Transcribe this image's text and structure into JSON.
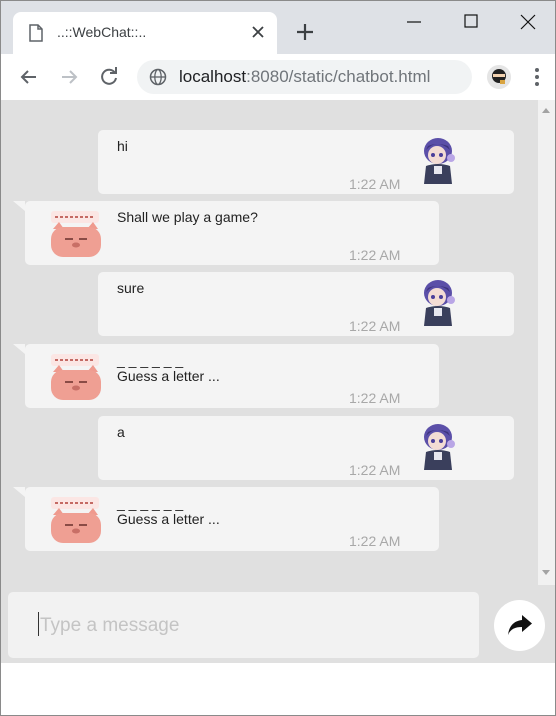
{
  "browser": {
    "tab_title": "..::WebChat::..",
    "url_host": "localhost",
    "url_path": ":8080/static/chatbot.html",
    "icons": {
      "tab": "page-icon",
      "close": "close-icon",
      "new_tab": "plus-icon",
      "back": "back-arrow-icon",
      "forward": "forward-arrow-icon",
      "reload": "reload-icon",
      "site_info": "globe-icon",
      "profile": "profile-avatar-icon",
      "menu": "kebab-menu-icon"
    }
  },
  "chat": {
    "messages": [
      {
        "sender": "user",
        "lines": [
          "hi"
        ],
        "time": "1:22 AM"
      },
      {
        "sender": "bot",
        "lines": [
          "Shall we play a game?"
        ],
        "time": "1:22 AM"
      },
      {
        "sender": "user",
        "lines": [
          "sure"
        ],
        "time": "1:22 AM"
      },
      {
        "sender": "bot",
        "lines": [
          "_ _ _ _ _ _",
          "Guess a letter ..."
        ],
        "time": "1:22 AM"
      },
      {
        "sender": "user",
        "lines": [
          "a"
        ],
        "time": "1:22 AM"
      },
      {
        "sender": "bot",
        "lines": [
          "_ _ _ _ _ _",
          "Guess a letter ..."
        ],
        "time": "1:22 AM"
      }
    ],
    "input_placeholder": "Type a message",
    "send_icon": "share-arrow-icon"
  },
  "colors": {
    "chat_background": "#e0e0e0",
    "bubble": "#f4f4f4",
    "timestamp": "#a8a8a8",
    "tabstrip": "#dee1e6"
  }
}
